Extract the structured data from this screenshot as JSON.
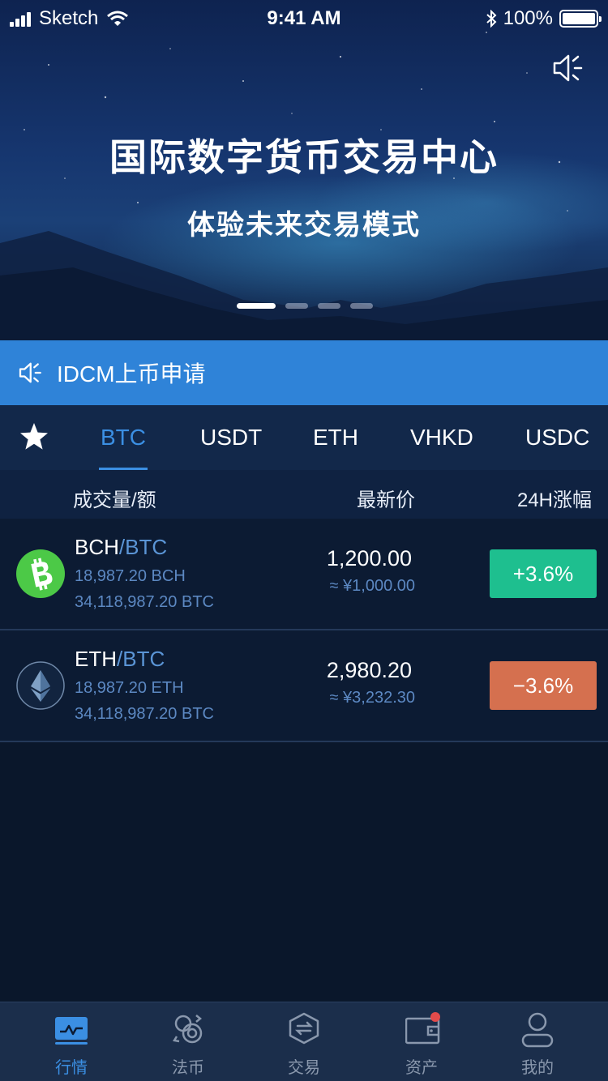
{
  "status_bar": {
    "carrier": "Sketch",
    "time": "9:41 AM",
    "battery": "100%"
  },
  "banner": {
    "title": "国际数字货币交易中心",
    "subtitle": "体验未来交易模式",
    "slide_count": 4,
    "active_slide": 1,
    "sound_icon": "speaker-icon"
  },
  "notice": {
    "icon": "speaker-icon",
    "text": "IDCM上币申请"
  },
  "tabs": {
    "favorite_icon": "star-icon",
    "items": [
      "BTC",
      "USDT",
      "ETH",
      "VHKD",
      "USDC"
    ],
    "active": "BTC"
  },
  "columns": {
    "volume": "成交量/额",
    "price": "最新价",
    "change": "24H涨幅"
  },
  "markets": [
    {
      "base": "BCH",
      "quote": "/BTC",
      "icon": "bitcoin-cash-icon",
      "volume_base": "18,987.20 BCH",
      "volume_quote": "34,118,987.20 BTC",
      "price": "1,200.00",
      "price_cny": "≈ ¥1,000.00",
      "change": "+3.6%",
      "change_color": "#1ebf8f"
    },
    {
      "base": "ETH",
      "quote": "/BTC",
      "icon": "ethereum-icon",
      "volume_base": "18,987.20 ETH",
      "volume_quote": "34,118,987.20 BTC",
      "price": "2,980.20",
      "price_cny": "≈ ¥3,232.30",
      "change": "−3.6%",
      "change_color": "#d5704f"
    }
  ],
  "bottom_nav": {
    "items": [
      {
        "label": "行情",
        "icon": "market-chart-icon"
      },
      {
        "label": "法币",
        "icon": "fiat-exchange-icon"
      },
      {
        "label": "交易",
        "icon": "trade-hexagon-icon"
      },
      {
        "label": "资产",
        "icon": "wallet-icon"
      },
      {
        "label": "我的",
        "icon": "profile-icon"
      }
    ],
    "active": "行情"
  },
  "colors": {
    "accent": "#3b8fe3",
    "notice_bg": "#2f83d8",
    "background": "#0a172b",
    "up": "#1ebf8f",
    "down": "#d5704f"
  }
}
